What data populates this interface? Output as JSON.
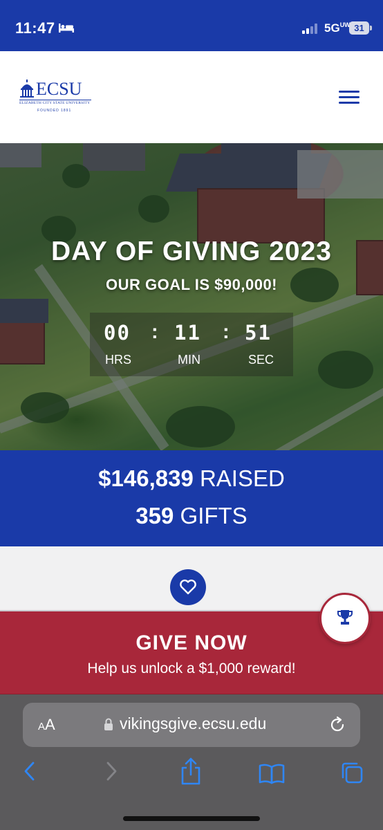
{
  "status_bar": {
    "time": "11:47",
    "network": "5G",
    "network_sup": "UW",
    "battery": "31",
    "icons": [
      "bed-icon",
      "signal-icon",
      "battery-icon"
    ]
  },
  "header": {
    "logo_text": "ECSU",
    "logo_subtitle": "ELIZABETH CITY STATE UNIVERSITY",
    "logo_founded": "FOUNDED 1891",
    "menu_icon": "hamburger-menu-icon"
  },
  "hero": {
    "title": "DAY OF GIVING 2023",
    "goal": "OUR GOAL IS $90,000!",
    "countdown": {
      "hours": "00",
      "minutes": "11",
      "seconds": "51",
      "hours_label": "HRS",
      "minutes_label": "MIN",
      "seconds_label": "SEC",
      "separator": ":"
    }
  },
  "stats": {
    "raised_amount": "$146,839",
    "raised_label": "RAISED",
    "gifts_count": "359",
    "gifts_label": "GIFTS"
  },
  "heart_icon": "heart-icon",
  "give_now": {
    "title": "GIVE NOW",
    "subtitle": "Help us unlock a $1,000 reward!",
    "trophy_icon": "trophy-icon"
  },
  "browser": {
    "aa_label_small": "A",
    "aa_label": "A",
    "url": "vikingsgive.ecsu.edu",
    "toolbar_icons": [
      "back-icon",
      "forward-icon",
      "share-icon",
      "bookmarks-icon",
      "tabs-icon"
    ]
  },
  "colors": {
    "brand_blue": "#1a3aa8",
    "give_red": "#a8273a",
    "safari_gray": "#5b5a5c"
  }
}
